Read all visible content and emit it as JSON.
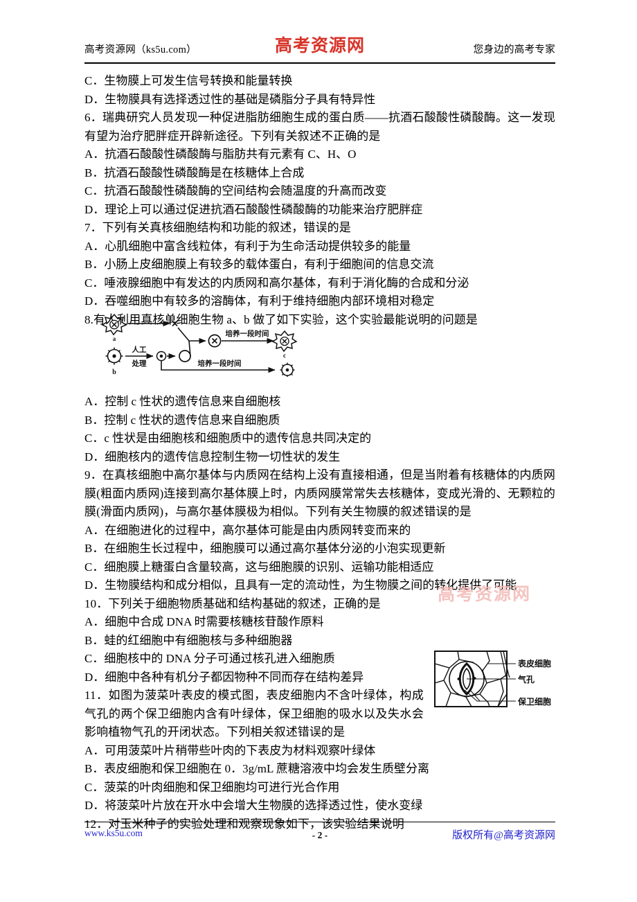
{
  "header": {
    "left_text": "高考资源网（ks5u.com）",
    "logo_text": "高考资源网",
    "right_text": "您身边的高考专家",
    "logo_color": "#d8342a"
  },
  "watermark": {
    "text": "高考资源网",
    "color": "#f3b9b6"
  },
  "footer": {
    "left_text": "www.ks5u.com",
    "page_number": "- 2 -",
    "right_text": "版权所有@高考资源网",
    "link_color": "#2222cc"
  },
  "content": {
    "q5_tail": [
      "C．生物膜上可发生信号转换和能量转换",
      "D．生物膜具有选择透过性的基础是磷脂分子具有特异性"
    ],
    "q6": {
      "stem": "6．瑞典研究人员发现一种促进脂肪细胞生成的蛋白质——抗酒石酸酸性磷酸酶。这一发现有望为治疗肥胖症开辟新途径。下列有关叙述不正确的是",
      "options": [
        "A．抗酒石酸酸性磷酸酶与脂肪共有元素有 C、H、O",
        "B．抗酒石酸酸性磷酸酶是在核糖体上合成",
        "C．抗酒石酸酸性磷酸酶的空间结构会随温度的升高而改变",
        "D．理论上可以通过促进抗酒石酸酸性磷酸酶的功能来治疗肥胖症"
      ]
    },
    "q7": {
      "stem": "7．下列有关真核细胞结构和功能的叙述，错误的是",
      "options": [
        "A．心肌细胞中富含线粒体，有利于为生命活动提供较多的能量",
        "B．小肠上皮细胞膜上有较多的载体蛋白，有利于细胞间的信息交流",
        "C．唾液腺细胞中有发达的内质网和高尔基体，有利于消化酶的合成和分泌",
        "D．吞噬细胞中有较多的溶酶体，有利于维持细胞内部环境相对稳定"
      ]
    },
    "q8": {
      "stem": "8.有人利用真核单细胞生物 a、b 做了如下实验，这个实验最能说明的问题是",
      "figure": {
        "label_a": "a",
        "label_b": "b",
        "label_c": "c",
        "treatment": "人工处理",
        "treatment_line1": "人工",
        "treatment_line2": "处理",
        "culture_top": "培养一段时间",
        "culture_bottom": "培养一段时间"
      },
      "options": [
        "A．控制 c 性状的遗传信息来自细胞核",
        "B．控制 c 性状的遗传信息来自细胞质",
        "C．c 性状是由细胞核和细胞质中的遗传信息共同决定的",
        "D．细胞核内的遗传信息控制生物一切性状的发生"
      ]
    },
    "q9": {
      "stem": "9．在真核细胞中高尔基体与内质网在结构上没有直接相通，但是当附着有核糖体的内质网膜(粗面内质网)连接到高尔基体膜上时，内质网膜常常失去核糖体，变成光滑的、无颗粒的膜(滑面内质网)，与高尔基体膜极为相似。下列有关生物膜的叙述错误的是",
      "options": [
        "A．在细胞进化的过程中，高尔基体可能是由内质网转变而来的",
        "B．在细胞生长过程中，细胞膜可以通过高尔基体分泌的小泡实现更新",
        "C．细胞膜上糖蛋白含量较高，这与细胞膜的识别、运输功能相适应",
        "D．生物膜结构和成分相似，且具有一定的流动性，为生物膜之间的转化提供了可能"
      ]
    },
    "q10": {
      "stem": "10．下列关于细胞物质基础和结构基础的叙述，正确的是",
      "options": [
        "A．细胞中合成 DNA 时需要核糖核苷酸作原料",
        "B．蛙的红细胞中有细胞核与多种细胞器",
        "C．细胞核中的 DNA 分子可通过核孔进入细胞质",
        "D．细胞中各种有机分子都因物种不同而存在结构差异"
      ]
    },
    "q11": {
      "stem": "11．如图为菠菜叶表皮的模式图，表皮细胞内不含叶绿体，构成气孔的两个保卫细胞内含有叶绿体，保卫细胞的吸水以及失水会影响植物气孔的开闭状态。下列相关叙述错误的是",
      "figure": {
        "label_epidermal": "表皮细胞",
        "label_stoma": "气孔",
        "label_guard": "保卫细胞"
      },
      "options": [
        "A．可用菠菜叶片稍带些叶肉的下表皮为材料观察叶绿体",
        "B．表皮细胞和保卫细胞在 0．3g/mL 蔗糖溶液中均会发生质壁分离",
        "C．菠菜的叶肉细胞和保卫细胞均可进行光合作用",
        "D．将菠菜叶片放在开水中会增大生物膜的选择透过性，使水变绿"
      ]
    },
    "q12": {
      "stem": "12．对玉米种子的实验处理和观察现象如下，该实验结果说明"
    }
  }
}
